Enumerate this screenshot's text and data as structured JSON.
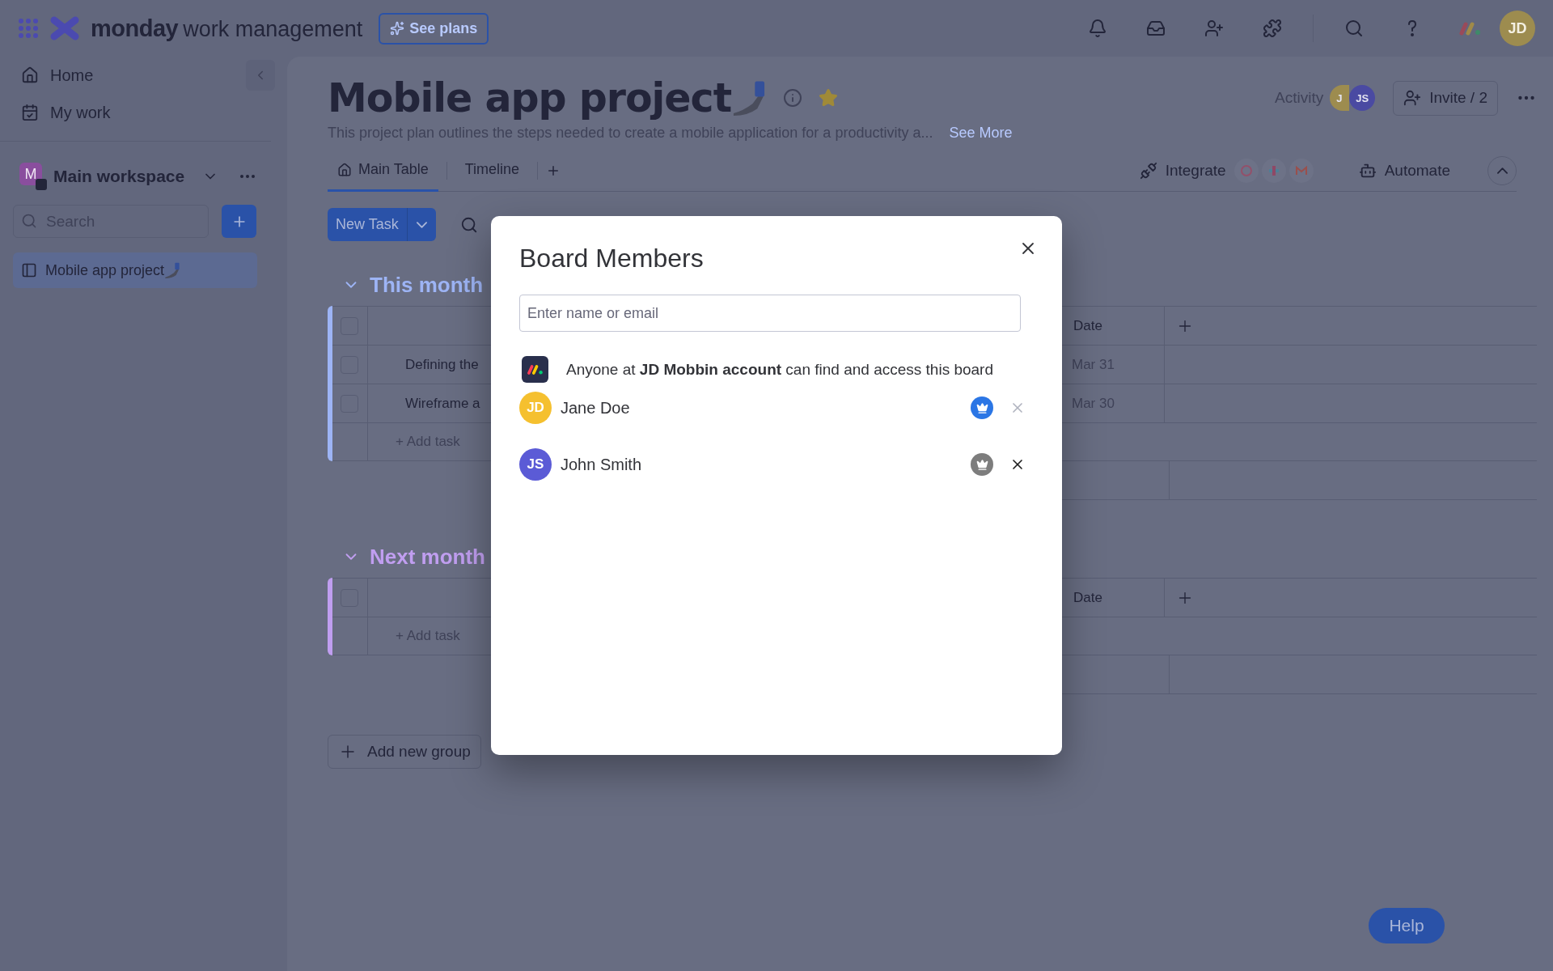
{
  "top_bar": {
    "brand": "monday",
    "product": "work management",
    "see_plans": "See plans",
    "avatar": "JD"
  },
  "sidebar": {
    "nav": [
      {
        "label": "Home",
        "kind": "home"
      },
      {
        "label": "My work",
        "kind": "work"
      }
    ],
    "workspace": {
      "initial": "M",
      "name": "Main workspace"
    },
    "search": {
      "placeholder": "Search"
    },
    "boards": [
      {
        "label": "Mobile app project",
        "selected": true
      }
    ]
  },
  "board": {
    "title": "Mobile app project",
    "description": "This project plan outlines the steps needed to create a mobile application for a productivity a...",
    "see_more": "See More",
    "activity": "Activity",
    "activity_avatars": [
      {
        "initials": "J",
        "color": "#9d8c4f"
      },
      {
        "initials": "JS",
        "color": "#4a4aa2"
      }
    ],
    "invite": "Invite / 2",
    "tabs": [
      {
        "label": "Main Table",
        "selected": true
      },
      {
        "label": "Timeline",
        "selected": false
      }
    ],
    "integrate": "Integrate",
    "automate": "Automate",
    "new_task": "New Task",
    "groups": [
      {
        "title": "This month",
        "color": "#9db4f5",
        "date_column": "Date",
        "all_checked": false,
        "rows": [
          {
            "task": "Defining the",
            "date": "Mar 31",
            "checked": false
          },
          {
            "task": "Wireframe a",
            "date": "Mar 30",
            "checked": false
          }
        ],
        "add_task": "+ Add task"
      },
      {
        "title": "Next month",
        "color": "#c09ef0",
        "date_column": "Date",
        "all_checked": false,
        "add_task": "+ Add task"
      }
    ],
    "add_group": "Add new group"
  },
  "help": "Help",
  "modal": {
    "title": "Board Members",
    "input": {
      "placeholder": "Enter name or email"
    },
    "access_note": "Anyone at **JD Mobbin account** can find and access this board",
    "members": [
      {
        "initials": "JD",
        "name": "Jane Doe",
        "color": "#f5c02f",
        "owner": true,
        "removable": false
      },
      {
        "initials": "JS",
        "name": "John Smith",
        "color": "#5b5bd6",
        "owner": false,
        "removable": true
      }
    ]
  }
}
